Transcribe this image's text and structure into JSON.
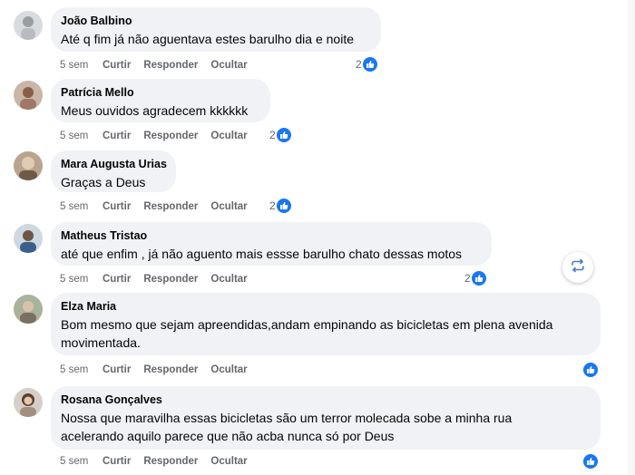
{
  "comments": [
    {
      "author": "João Balbino",
      "text": "Até q fim já não aguentava estes barulho dia e noite",
      "time": "5 sem",
      "like": "Curtir",
      "reply": "Responder",
      "hide": "Ocultar",
      "reactions": "2"
    },
    {
      "author": "Patrícia Mello",
      "text": "Meus ouvidos agradecem kkkkkk",
      "time": "5 sem",
      "like": "Curtir",
      "reply": "Responder",
      "hide": "Ocultar",
      "reactions": "2"
    },
    {
      "author": "Mara Augusta Urias",
      "text": "Graças a Deus",
      "time": "5 sem",
      "like": "Curtir",
      "reply": "Responder",
      "hide": "Ocultar",
      "reactions": "2"
    },
    {
      "author": "Matheus Tristao",
      "text": "até que enfim , já não aguento mais essse barulho chato dessas motos",
      "time": "5 sem",
      "like": "Curtir",
      "reply": "Responder",
      "hide": "Ocultar",
      "reactions": "2"
    },
    {
      "author": "Elza Maria",
      "text_line1": "Bom mesmo que sejam apreendidas,andam empinando as bicicletas em plena avenida",
      "text_line2": "movimentada.",
      "time": "5 sem",
      "like": "Curtir",
      "reply": "Responder",
      "hide": "Ocultar"
    },
    {
      "author": "Rosana Gonçalves",
      "text_line1": "Nossa que maravilha essas bicicletas são um terror molecada sobe a minha rua",
      "text_line2": "acelerando aquilo parece que não acba nunca só por Deus",
      "time": "5 sem",
      "like": "Curtir",
      "reply": "Responder",
      "hide": "Ocultar"
    }
  ],
  "icons": {
    "like": "thumbs-up-icon",
    "share": "repost-icon"
  },
  "colors": {
    "bubble": "#f0f2f5",
    "accent": "#1877f2",
    "muted": "#65676b"
  }
}
